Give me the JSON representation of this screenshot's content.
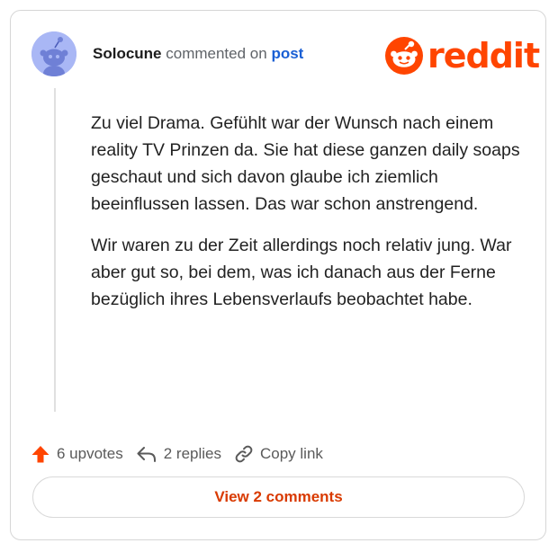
{
  "comment": {
    "username": "Solocune",
    "verb": "commented on",
    "target": "post",
    "paragraphs": [
      "Zu viel Drama. Gefühlt war der Wunsch nach einem reality TV Prinzen da. Sie hat diese ganzen daily soaps geschaut und sich davon glaube ich ziemlich beeinflussen lassen. Das war schon anstrengend.",
      "Wir waren zu der Zeit allerdings noch relativ jung. War aber gut so, bei dem, was ich danach aus der Ferne bezüglich ihres Lebensverlaufs beobachtet habe."
    ]
  },
  "brand": {
    "logo_text": "reddit",
    "color": "#ff4500"
  },
  "actions": {
    "upvotes": "6 upvotes",
    "replies": "2 replies",
    "copy_link": "Copy link"
  },
  "view_button": "View 2 comments",
  "icons": [
    "snoo-avatar-icon",
    "reddit-logo-icon",
    "upvote-arrow-icon",
    "reply-icon",
    "link-icon"
  ]
}
